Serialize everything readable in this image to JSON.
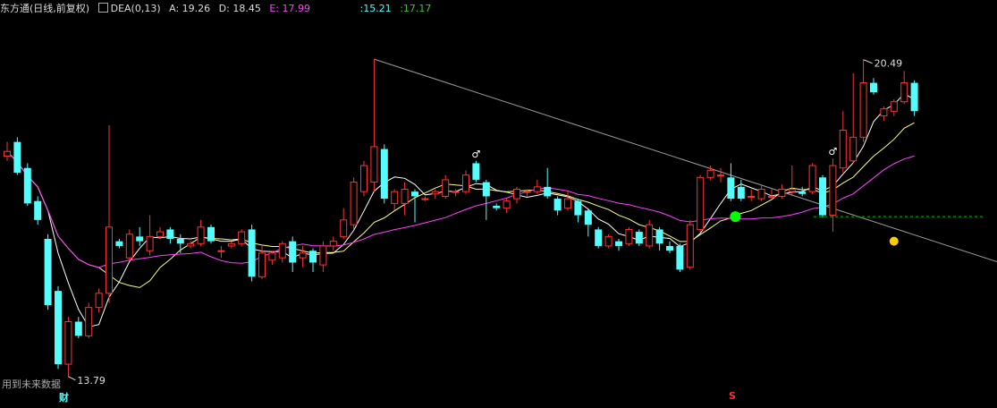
{
  "header": {
    "name": "东方通(日线,前复权)",
    "dea": "DEA(0,13)",
    "a": "A: 19.26",
    "d": "D: 18.45",
    "e": "E: 17.99",
    "v1": ":15.21",
    "v2": ":17.17"
  },
  "footer": {
    "note": "用到未来数据",
    "mark_cai": "财",
    "mark_s": "S"
  },
  "colors": {
    "background": "#000000",
    "up": "#ff3232",
    "down": "#54fcfc",
    "ma_white": "#ffffff",
    "ma_yellow": "#ffff80",
    "ma_magenta": "#ff40ff",
    "trendline": "#9a9a9a",
    "dot_green": "#00ff00",
    "dot_yellow": "#ffcc00",
    "dashed": "#00c000"
  },
  "chart_data": {
    "type": "candlestick",
    "ylim": [
      13.2,
      21.6
    ],
    "grid": false,
    "annotations": {
      "high_label": "20.49",
      "low_label": "13.79",
      "high_value": 20.49,
      "low_value": 13.79,
      "symbol": "♂",
      "dashed_level": 17.17
    },
    "candles": [
      [
        18.45,
        18.55,
        18.75,
        18.35
      ],
      [
        18.75,
        18.1,
        18.85,
        18.05
      ],
      [
        18.2,
        17.45,
        18.3,
        17.4
      ],
      [
        17.5,
        17.1,
        17.6,
        17.0
      ],
      [
        16.7,
        15.3,
        16.8,
        15.2
      ],
      [
        15.6,
        14.05,
        15.7,
        13.95
      ],
      [
        14.05,
        14.95,
        15.05,
        13.79
      ],
      [
        14.95,
        14.65,
        15.05,
        14.6
      ],
      [
        14.65,
        15.25,
        15.35,
        14.6
      ],
      [
        15.25,
        15.55,
        15.65,
        15.15
      ],
      [
        15.55,
        16.95,
        19.1,
        15.35
      ],
      [
        16.65,
        16.55,
        16.7,
        16.5
      ],
      [
        16.3,
        16.8,
        16.9,
        16.25
      ],
      [
        16.75,
        16.65,
        16.95,
        16.55
      ],
      [
        16.45,
        16.75,
        17.2,
        16.35
      ],
      [
        16.75,
        16.85,
        16.95,
        16.7
      ],
      [
        16.9,
        16.7,
        16.95,
        16.6
      ],
      [
        16.7,
        16.6,
        16.8,
        16.4
      ],
      [
        16.55,
        16.6,
        16.65,
        16.5
      ],
      [
        16.6,
        16.95,
        17.1,
        16.55
      ],
      [
        16.95,
        16.65,
        17.0,
        16.6
      ],
      [
        16.45,
        16.45,
        16.55,
        16.3
      ],
      [
        16.55,
        16.6,
        16.65,
        16.5
      ],
      [
        16.6,
        16.85,
        16.9,
        16.55
      ],
      [
        16.9,
        15.9,
        17.0,
        15.8
      ],
      [
        15.9,
        16.4,
        16.55,
        15.85
      ],
      [
        16.25,
        16.4,
        16.45,
        16.15
      ],
      [
        16.3,
        16.6,
        16.65,
        16.2
      ],
      [
        16.65,
        16.2,
        16.75,
        16.0
      ],
      [
        16.3,
        16.4,
        16.55,
        16.1
      ],
      [
        16.45,
        16.2,
        16.5,
        16.0
      ],
      [
        16.15,
        16.55,
        16.65,
        16.0
      ],
      [
        16.55,
        16.65,
        16.75,
        16.45
      ],
      [
        16.75,
        17.1,
        17.35,
        16.7
      ],
      [
        17.0,
        17.9,
        18.0,
        16.9
      ],
      [
        17.7,
        18.25,
        18.35,
        17.6
      ],
      [
        17.9,
        18.65,
        20.5,
        17.7
      ],
      [
        18.6,
        17.55,
        18.7,
        17.45
      ],
      [
        17.45,
        17.7,
        17.75,
        17.3
      ],
      [
        17.45,
        17.75,
        17.9,
        17.2
      ],
      [
        17.7,
        17.6,
        17.75,
        17.05
      ],
      [
        17.55,
        17.55,
        17.6,
        17.5
      ],
      [
        17.65,
        17.7,
        17.75,
        17.55
      ],
      [
        17.6,
        17.95,
        18.05,
        17.55
      ],
      [
        17.7,
        17.7,
        17.75,
        17.6
      ],
      [
        17.7,
        18.05,
        18.15,
        17.65
      ],
      [
        18.3,
        17.95,
        18.35,
        17.9
      ],
      [
        17.9,
        17.6,
        17.95,
        17.1
      ],
      [
        17.4,
        17.35,
        17.45,
        17.3
      ],
      [
        17.35,
        17.5,
        17.55,
        17.25
      ],
      [
        17.55,
        17.75,
        17.8,
        17.45
      ],
      [
        17.7,
        17.7,
        17.75,
        17.6
      ],
      [
        17.7,
        17.8,
        17.95,
        17.65
      ],
      [
        17.8,
        17.6,
        18.2,
        17.55
      ],
      [
        17.55,
        17.3,
        17.6,
        17.2
      ],
      [
        17.35,
        17.55,
        17.7,
        17.3
      ],
      [
        17.5,
        17.2,
        17.55,
        17.05
      ],
      [
        17.3,
        17.0,
        17.35,
        16.75
      ],
      [
        16.9,
        16.55,
        16.95,
        16.5
      ],
      [
        16.55,
        16.75,
        16.8,
        16.5
      ],
      [
        16.65,
        16.55,
        16.7,
        16.45
      ],
      [
        16.6,
        16.9,
        16.95,
        16.55
      ],
      [
        16.85,
        16.6,
        16.9,
        16.55
      ],
      [
        16.55,
        17.0,
        17.1,
        16.5
      ],
      [
        16.9,
        16.6,
        16.95,
        16.45
      ],
      [
        16.55,
        16.45,
        16.65,
        16.4
      ],
      [
        16.55,
        16.05,
        16.6,
        16.0
      ],
      [
        16.1,
        17.0,
        17.1,
        16.05
      ],
      [
        16.9,
        18.0,
        18.05,
        16.85
      ],
      [
        18.0,
        18.15,
        18.25,
        17.95
      ],
      [
        18.05,
        18.05,
        18.2,
        17.9
      ],
      [
        18.0,
        17.55,
        18.3,
        17.5
      ],
      [
        17.8,
        17.55,
        17.95,
        17.5
      ],
      [
        17.6,
        17.6,
        17.75,
        17.5
      ],
      [
        17.55,
        17.75,
        17.85,
        17.5
      ],
      [
        17.6,
        17.6,
        17.75,
        17.55
      ],
      [
        17.6,
        17.75,
        17.85,
        17.55
      ],
      [
        17.7,
        17.75,
        18.25,
        17.6
      ],
      [
        17.7,
        17.65,
        17.8,
        17.6
      ],
      [
        17.7,
        18.25,
        18.3,
        17.65
      ],
      [
        18.0,
        17.2,
        18.05,
        17.15
      ],
      [
        17.2,
        18.25,
        18.4,
        16.85
      ],
      [
        18.2,
        19.0,
        19.4,
        18.1
      ],
      [
        18.35,
        18.85,
        20.2,
        18.3
      ],
      [
        18.85,
        20.0,
        20.49,
        18.75
      ],
      [
        20.0,
        19.8,
        20.1,
        19.75
      ],
      [
        19.3,
        19.45,
        19.5,
        19.2
      ],
      [
        19.4,
        19.6,
        19.65,
        19.3
      ],
      [
        19.6,
        20.0,
        20.25,
        19.55
      ],
      [
        20.0,
        19.4,
        20.05,
        19.3
      ]
    ]
  }
}
